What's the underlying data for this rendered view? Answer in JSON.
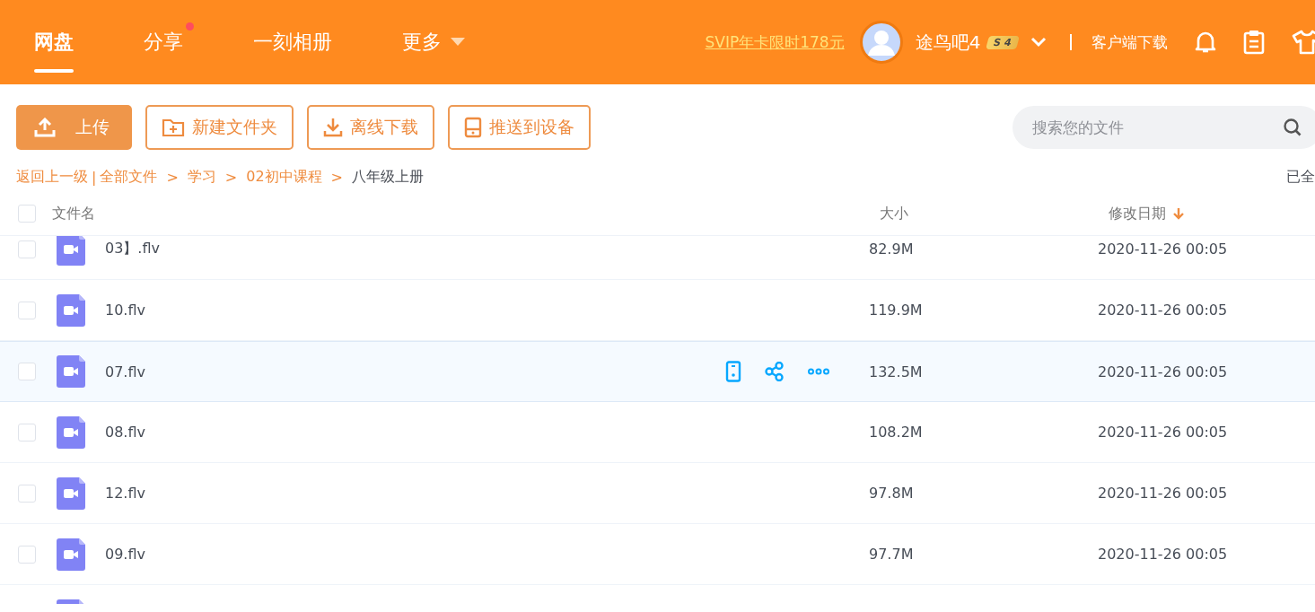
{
  "nav": {
    "tabs": [
      {
        "label": "网盘",
        "selected": true,
        "dot": false,
        "caret": false
      },
      {
        "label": "分享",
        "selected": false,
        "dot": true,
        "caret": false
      },
      {
        "label": "一刻相册",
        "selected": false,
        "dot": false,
        "caret": false
      },
      {
        "label": "更多",
        "selected": false,
        "dot": false,
        "caret": true
      }
    ],
    "promo": "SVIP年卡限时178元",
    "user": {
      "name": "途鸟吧4",
      "badge": [
        "S",
        "4"
      ]
    },
    "client_download": "客户端下载"
  },
  "toolbar": {
    "buttons": [
      {
        "kind": "primary",
        "label": "上传"
      },
      {
        "kind": "outline",
        "label": "新建文件夹"
      },
      {
        "kind": "outline",
        "label": "离线下载"
      },
      {
        "kind": "outline",
        "label": "推送到设备"
      }
    ],
    "search": {
      "placeholder": "搜索您的文件"
    }
  },
  "breadcrumb": {
    "back": "返回上一级",
    "items": [
      {
        "separator": "|",
        "label": "全部文件",
        "current": false
      },
      {
        "separator": ">",
        "label": "学习",
        "current": false
      },
      {
        "separator": ">",
        "label": "02初中课程",
        "current": false
      },
      {
        "separator": ">",
        "label": "八年级上册",
        "current": true
      }
    ],
    "status": "已全"
  },
  "table": {
    "columns": [
      "文件名",
      "大小",
      "修改日期"
    ],
    "all_checked": false,
    "rows": [
      {
        "name": "03】.flv",
        "size": "82.9M",
        "date": "2020-11-26 00:05",
        "hovered": false,
        "checked": false
      },
      {
        "name": "10.flv",
        "size": "119.9M",
        "date": "2020-11-26 00:05",
        "hovered": false,
        "checked": false
      },
      {
        "name": "07.flv",
        "size": "132.5M",
        "date": "2020-11-26 00:05",
        "hovered": true,
        "checked": false
      },
      {
        "name": "08.flv",
        "size": "108.2M",
        "date": "2020-11-26 00:05",
        "hovered": false,
        "checked": false
      },
      {
        "name": "12.flv",
        "size": "97.8M",
        "date": "2020-11-26 00:05",
        "hovered": false,
        "checked": false
      },
      {
        "name": "09.flv",
        "size": "97.7M",
        "date": "2020-11-26 00:05",
        "hovered": false,
        "checked": false
      }
    ]
  }
}
